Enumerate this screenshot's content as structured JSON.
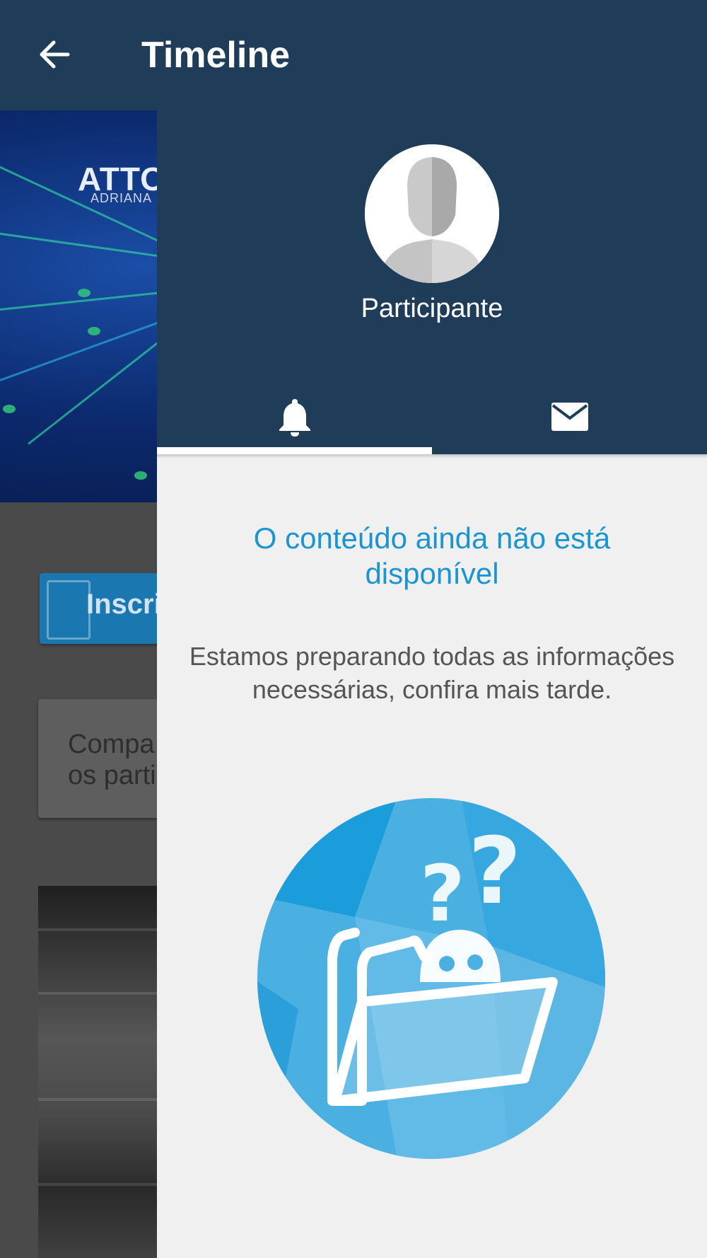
{
  "app_bar": {
    "title": "Timeline",
    "back_icon": "arrow-back-icon",
    "background": "#1f3d59"
  },
  "background_page": {
    "hero_logo": "ATTO",
    "hero_logo_sub": "ADRIANA",
    "button_label": "Inscri",
    "card_text": "Compa\nos parti"
  },
  "drawer": {
    "profile_name": "Participante",
    "avatar_icon": "person-silhouette-icon",
    "tabs": [
      {
        "icon": "bell-icon",
        "selected": true
      },
      {
        "icon": "mail-icon",
        "selected": false
      }
    ],
    "empty_state": {
      "title": "O conteúdo ainda não está disponível",
      "description": "Estamos preparando todas as informações necessárias, confira mais tarde.",
      "illustration_icon": "empty-folder-question-icon"
    },
    "accent_color": "#1a95d1"
  }
}
